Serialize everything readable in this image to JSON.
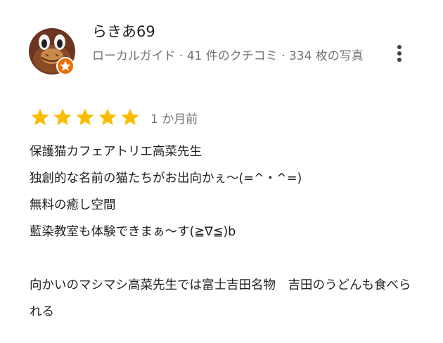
{
  "reviewer": {
    "name": "らきあ69",
    "meta": "ローカルガイド · 41 件のクチコミ · 334 枚の写真"
  },
  "rating": {
    "value": 5,
    "max": 5,
    "star_color": "#fbbc04",
    "date": "1 か月前"
  },
  "badge": {
    "icon": "star-badge-icon",
    "color": "#e8710a"
  },
  "menu": {
    "icon": "more-vert-icon"
  },
  "review": {
    "lines": [
      "保護猫カフェアトリエ高菜先生",
      "独創的な名前の猫たちがお出向かぇ〜(=^・^=)",
      "無料の癒し空間",
      "藍染教室も体験できまぁ〜す(≧∇≦)b",
      "",
      "向かいのマシマシ高菜先生では富士吉田名物　吉田のうどんも食べられる"
    ]
  }
}
